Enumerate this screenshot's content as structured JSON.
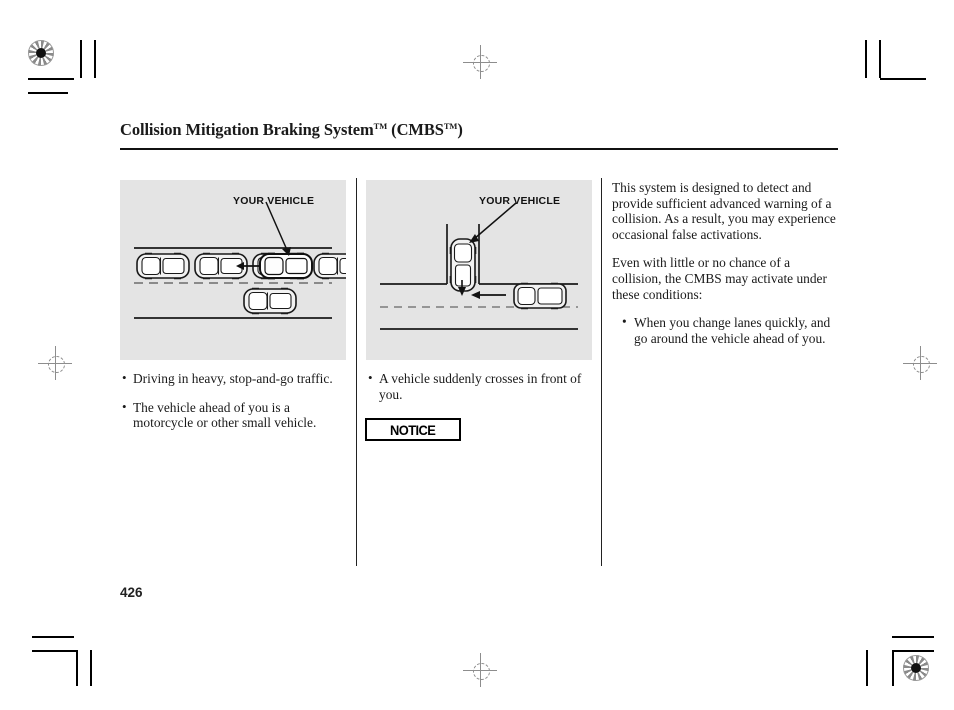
{
  "document": {
    "page_number": "426",
    "title": {
      "main": "Collision Mitigation Braking System",
      "tm1": "TM",
      "paren_open": " (CMBS",
      "tm2": "TM",
      "paren_close": ")"
    }
  },
  "figures": [
    {
      "name": "stop-and-go-traffic-illustration",
      "callout_label": "YOUR VEHICLE",
      "background_color": "#e4e4e4",
      "description": "Overhead view of a line of cars in heavy stop-and-go traffic with your vehicle highlighted"
    },
    {
      "name": "intersection-crossing-illustration",
      "callout_label": "YOUR VEHICLE",
      "background_color": "#e4e4e4",
      "description": "Overhead view of a T intersection where a vehicle crosses in front of your vehicle"
    }
  ],
  "column_one": {
    "bullets": [
      "Driving in heavy, stop-and-go traffic.",
      "The vehicle ahead of you is a motorcycle or other small vehicle."
    ]
  },
  "column_two": {
    "bullets": [
      "A vehicle suddenly crosses in front of you."
    ],
    "notice_label": "NOTICE"
  },
  "column_three": {
    "paragraphs": [
      "This system is designed to detect and provide sufficient advanced warning of a collision. As a result, you may experience occasional false activations.",
      "Even with little or no chance of a collision, the CMBS may activate under these conditions:"
    ],
    "bullets": [
      "When you change lanes quickly, and go around the vehicle ahead of you."
    ]
  }
}
